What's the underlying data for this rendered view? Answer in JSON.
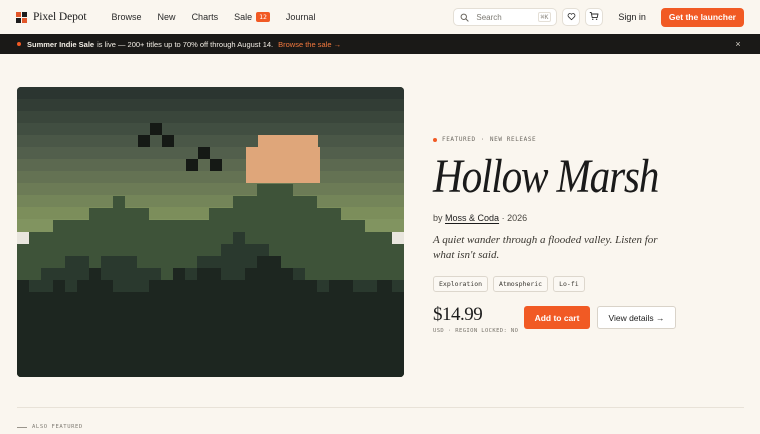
{
  "nav": {
    "brand": "Pixel Depot",
    "links": [
      {
        "label": "Browse"
      },
      {
        "label": "New"
      },
      {
        "label": "Charts"
      },
      {
        "label": "Sale",
        "badge": "12"
      },
      {
        "label": "Journal"
      }
    ],
    "search": {
      "placeholder": "Search",
      "shortcut": "⌘K"
    },
    "wishlist_icon": "heart-icon",
    "cart_icon": "cart-icon",
    "signin": "Sign in",
    "cta": "Get the launcher"
  },
  "banner": {
    "strong": "Summer Indie Sale",
    "text": "is live — 200+ titles up to 70% off through August 14.",
    "link": "Browse the sale →",
    "close": "×"
  },
  "hero": {
    "tag_featured": "FEATURED",
    "tag_sep": "·",
    "tag_new": "NEW RELEASE",
    "title": "Hollow Marsh",
    "by": "by",
    "studio": "Moss & Coda",
    "year": "· 2026",
    "description": "A quiet wander through a flooded valley. Listen for what isn't said.",
    "tags": [
      "Exploration",
      "Atmospheric",
      "Lo-fi"
    ],
    "price": "$14.99",
    "price_note": "USD · REGION LOCKED: NO",
    "add_to_cart": "Add to cart",
    "view_details": "View details →"
  },
  "section": {
    "also_featured": "ALSO FEATURED"
  },
  "colors": {
    "accent": "#f15a24",
    "background": "#faf6ef",
    "banner_bg": "#1a1917",
    "sun": "#dfa67a"
  }
}
